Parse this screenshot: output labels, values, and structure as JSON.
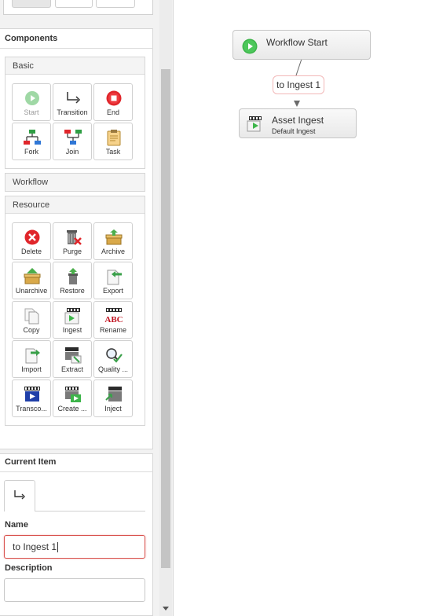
{
  "components": {
    "header": "Components",
    "basic": {
      "title": "Basic",
      "items": [
        {
          "label": "Start",
          "icon": "start-icon",
          "disabled": true
        },
        {
          "label": "Transition",
          "icon": "transition-icon"
        },
        {
          "label": "End",
          "icon": "end-icon"
        },
        {
          "label": "Fork",
          "icon": "fork-icon"
        },
        {
          "label": "Join",
          "icon": "join-icon"
        },
        {
          "label": "Task",
          "icon": "task-icon"
        }
      ]
    },
    "workflow": {
      "title": "Workflow"
    },
    "resource": {
      "title": "Resource",
      "items": [
        {
          "label": "Delete",
          "icon": "delete-icon"
        },
        {
          "label": "Purge",
          "icon": "purge-icon"
        },
        {
          "label": "Archive",
          "icon": "archive-icon"
        },
        {
          "label": "Unarchive",
          "icon": "unarchive-icon"
        },
        {
          "label": "Restore",
          "icon": "restore-icon"
        },
        {
          "label": "Export",
          "icon": "export-icon"
        },
        {
          "label": "Copy",
          "icon": "copy-icon"
        },
        {
          "label": "Ingest",
          "icon": "ingest-icon"
        },
        {
          "label": "Rename",
          "icon": "rename-icon"
        },
        {
          "label": "Import",
          "icon": "import-icon"
        },
        {
          "label": "Extract",
          "icon": "extract-icon"
        },
        {
          "label": "Quality ...",
          "icon": "quality-icon"
        },
        {
          "label": "Transco...",
          "icon": "transcode-icon"
        },
        {
          "label": "Create ...",
          "icon": "create-icon"
        },
        {
          "label": "Inject",
          "icon": "inject-icon"
        }
      ]
    }
  },
  "current_item": {
    "header": "Current Item",
    "name_label": "Name",
    "name_value": "to Ingest 1",
    "description_label": "Description",
    "description_value": ""
  },
  "canvas": {
    "start_node": {
      "title": "Workflow Start"
    },
    "edge_label": "to Ingest 1",
    "ingest_node": {
      "title": "Asset Ingest",
      "subtitle": "Default Ingest"
    }
  },
  "colors": {
    "start_green": "#3db54a",
    "end_red": "#e0262b",
    "focus_red": "#d9534f"
  }
}
